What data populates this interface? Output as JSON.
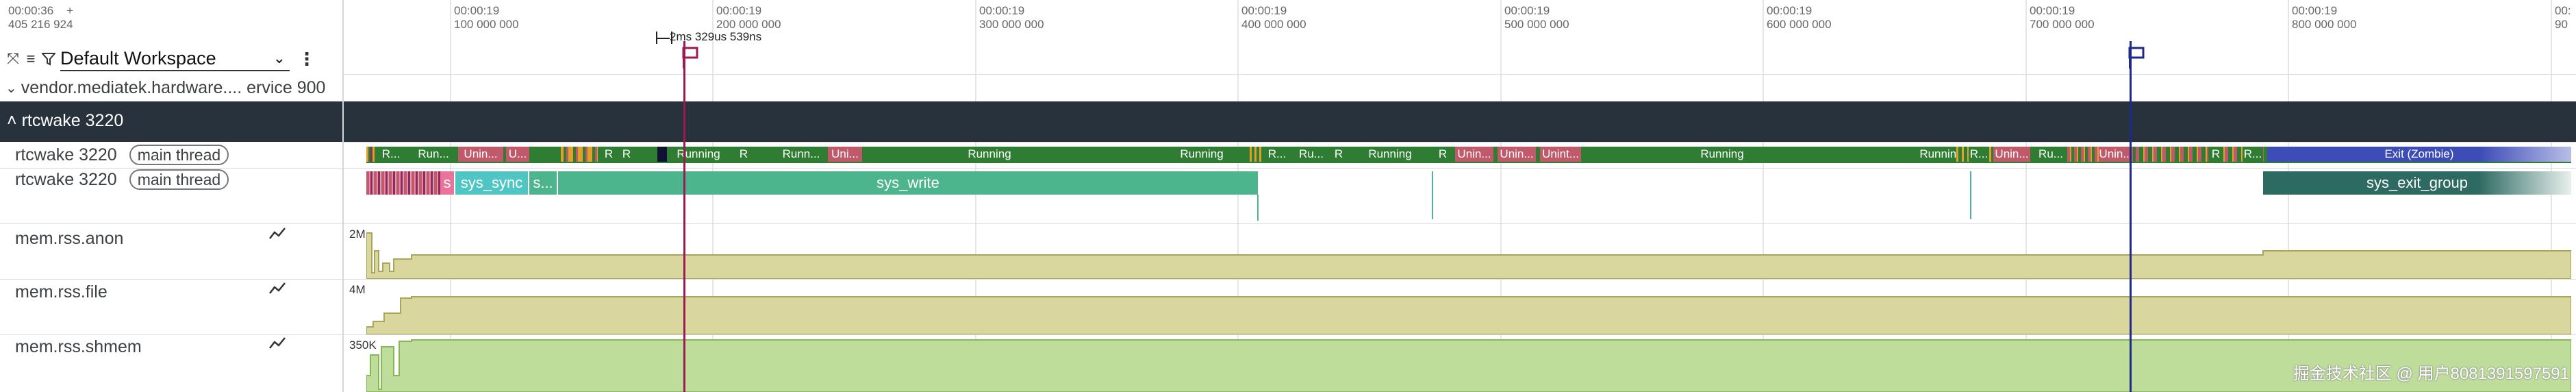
{
  "top_left": {
    "time": "00:00:36",
    "plus": "+",
    "ns": "405 216 924"
  },
  "ticks": [
    {
      "time": "00:00:19",
      "ns": "100 000 000"
    },
    {
      "time": "00:00:19",
      "ns": "200 000 000"
    },
    {
      "time": "00:00:19",
      "ns": "300 000 000"
    },
    {
      "time": "00:00:19",
      "ns": "400 000 000"
    },
    {
      "time": "00:00:19",
      "ns": "500 000 000"
    },
    {
      "time": "00:00:19",
      "ns": "600 000 000"
    },
    {
      "time": "00:00:19",
      "ns": "700 000 000"
    },
    {
      "time": "00:00:19",
      "ns": "800 000 000"
    },
    {
      "time": "00:",
      "ns": "90"
    }
  ],
  "toolbar": {
    "workspace": "Default Workspace"
  },
  "rows": {
    "vendor": "vendor.mediatek.hardware.... ervice 900",
    "group": "rtcwake 3220",
    "thread1_name": "rtcwake 3220",
    "thread1_badge": "main thread",
    "thread2_name": "rtcwake 3220",
    "thread2_badge": "main thread",
    "anon": "mem.rss.anon",
    "file": "mem.rss.file",
    "shmem": "mem.rss.shmem"
  },
  "scales": {
    "anon": "2M",
    "file": "4M",
    "shmem": "350K"
  },
  "marker_label": "2ms 329us 539ns",
  "colors": {
    "running": "#2e7d32",
    "uninterruptible": "#c0596a",
    "syscall": "#4cb58d",
    "exit_group": "#2d6b62",
    "zombie": "#3d4db7",
    "counter_olive": "#d9d79e",
    "counter_green": "#bedd9a",
    "marker_a": "#9c1a54",
    "marker_b": "#1e2a8a"
  },
  "state_slices": [
    {
      "label": "R...",
      "state": "running"
    },
    {
      "label": "Run...",
      "state": "running"
    },
    {
      "label": "Unin...",
      "state": "uninterruptible"
    },
    {
      "label": "U...",
      "state": "uninterruptible"
    },
    {
      "label": "R",
      "state": "running"
    },
    {
      "label": "R",
      "state": "running"
    },
    {
      "label": "Running",
      "state": "running"
    },
    {
      "label": "R",
      "state": "running"
    },
    {
      "label": "Runn...",
      "state": "running"
    },
    {
      "label": "Uni...",
      "state": "uninterruptible"
    },
    {
      "label": "Running",
      "state": "running"
    },
    {
      "label": "Running",
      "state": "running"
    },
    {
      "label": "R...",
      "state": "running"
    },
    {
      "label": "Ru...",
      "state": "running"
    },
    {
      "label": "R",
      "state": "running"
    },
    {
      "label": "Running",
      "state": "running"
    },
    {
      "label": "R",
      "state": "running"
    },
    {
      "label": "Unin...",
      "state": "uninterruptible"
    },
    {
      "label": "Unin...",
      "state": "uninterruptible"
    },
    {
      "label": "Unint...",
      "state": "uninterruptible"
    },
    {
      "label": "Running",
      "state": "running"
    },
    {
      "label": "Running",
      "state": "running"
    },
    {
      "label": "R...",
      "state": "running"
    },
    {
      "label": "Unin...",
      "state": "uninterruptible"
    },
    {
      "label": "Ru...",
      "state": "running"
    },
    {
      "label": "Unin...",
      "state": "uninterruptible"
    },
    {
      "label": "R",
      "state": "running"
    },
    {
      "label": "R...",
      "state": "running"
    },
    {
      "label": "Exit (Zombie)",
      "state": "zombie"
    }
  ],
  "syscall_slices": [
    {
      "label": "s",
      "kind": "pink"
    },
    {
      "label": "sys_sync",
      "kind": "teal"
    },
    {
      "label": "s...",
      "kind": "syscall"
    },
    {
      "label": "sys_write",
      "kind": "syscall"
    },
    {
      "label": "sys_exit_group",
      "kind": "exit"
    }
  ],
  "watermark": "掘金技术社区 @ 用户8081391597591"
}
